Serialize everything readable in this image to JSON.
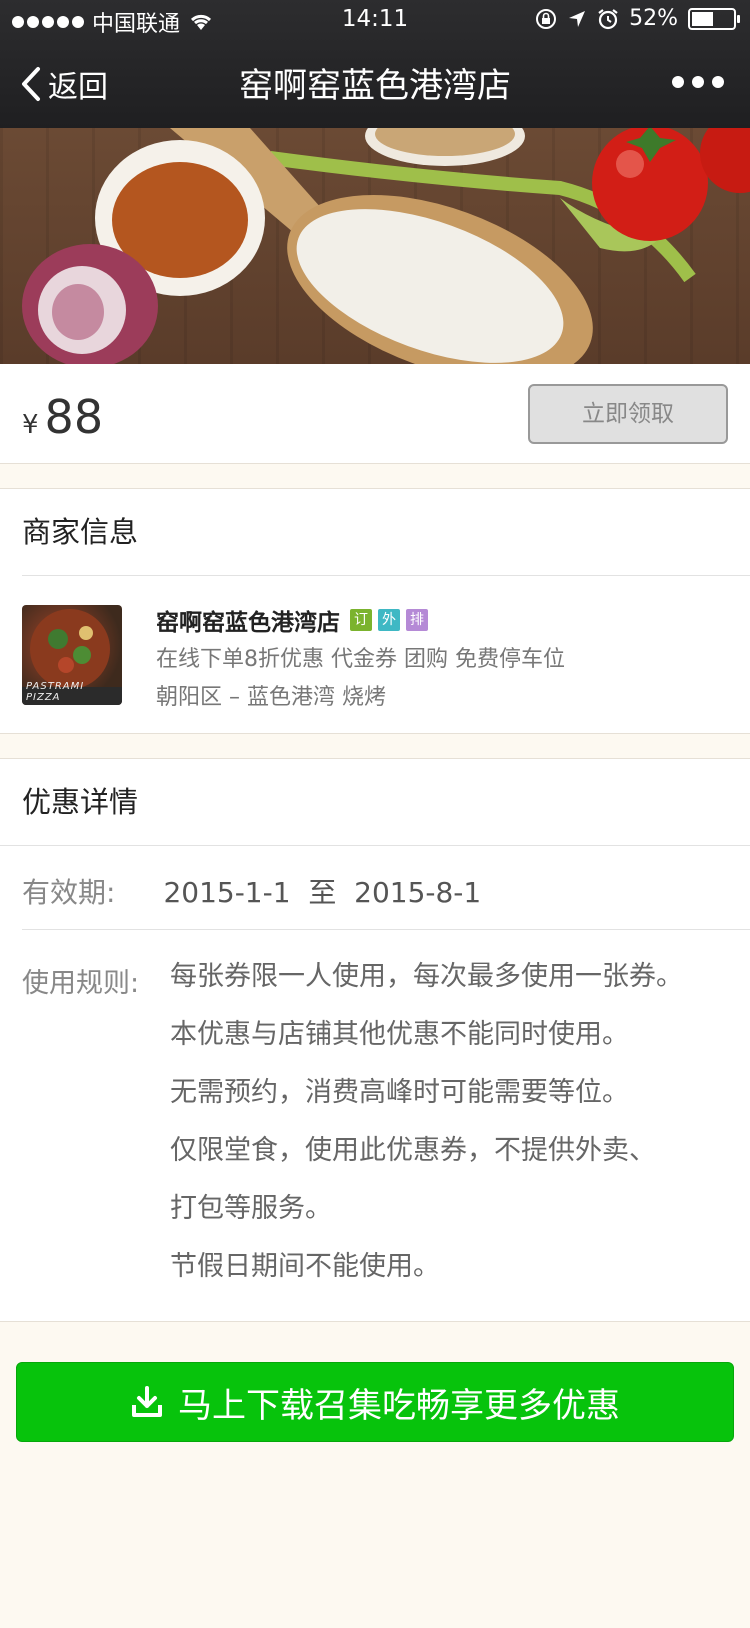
{
  "status_bar": {
    "carrier": "中国联通",
    "time": "14:11",
    "battery": "52%",
    "battery_level": 0.52
  },
  "nav": {
    "back_label": "返回",
    "title": "窑啊窑蓝色港湾店"
  },
  "coupon": {
    "currency": "¥",
    "price": "88",
    "claim_label": "立即领取"
  },
  "merchant_section": {
    "title": "商家信息",
    "name": "窑啊窑蓝色港湾店",
    "tags": [
      {
        "label": "订",
        "color": "#7bb32e"
      },
      {
        "label": "外",
        "color": "#3fb8c4"
      },
      {
        "label": "排",
        "color": "#b58ad6"
      }
    ],
    "features": "在线下单8折优惠  代金券  团购  免费停车位",
    "location": "朝阳区 – 蓝色港湾  烧烤",
    "thumb_caption": "PASTRAMI PIZZA"
  },
  "detail_section": {
    "title": "优惠详情",
    "validity_label": "有效期:",
    "validity_value": "2015-1-1  至  2015-8-1",
    "rules_label": "使用规则:",
    "rules": [
      "每张券限一人使用，每次最多使用一张券。",
      "本优惠与店铺其他优惠不能同时使用。",
      "无需预约，消费高峰时可能需要等位。",
      "仅限堂食，使用此优惠券，不提供外卖、",
      "打包等服务。",
      "节假日期间不能使用。"
    ]
  },
  "download": {
    "label": "马上下载召集吃畅享更多优惠"
  },
  "colors": {
    "accent_green": "#07c30c",
    "nav_bg": "#1f1f21",
    "page_bg": "#fdf9f1"
  }
}
